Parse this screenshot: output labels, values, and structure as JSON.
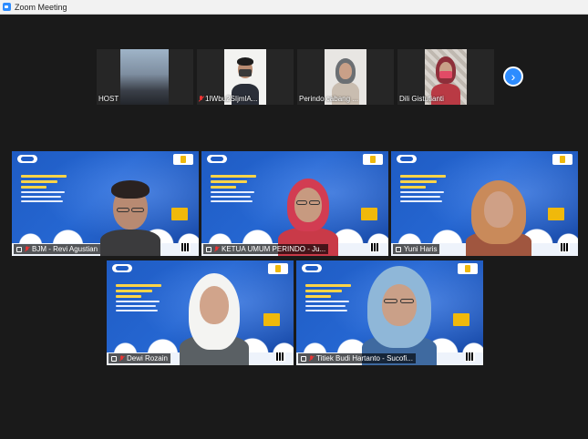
{
  "window": {
    "title": "Zoom Meeting"
  },
  "strip": {
    "tiles": [
      {
        "name": "HOST",
        "muted": false
      },
      {
        "name": "1IWbu2SIjmlA...",
        "muted": true
      },
      {
        "name": "Perindo cabang ...",
        "muted": false
      },
      {
        "name": "Dili Gistutianti",
        "muted": false
      }
    ],
    "next_icon": "chevron-right-icon"
  },
  "gallery": {
    "tiles": [
      {
        "name": "BJM - Revi Agustian",
        "muted": true
      },
      {
        "name": "KETUA UMUM PERINDO - Ju...",
        "muted": true
      },
      {
        "name": "Yuni Haris",
        "muted": false
      },
      {
        "name": "Dewi Rozain",
        "muted": true
      },
      {
        "name": "Titiek Budi Hartanto - Sucofi...",
        "muted": true
      }
    ]
  },
  "colors": {
    "background": "#1a1a1a",
    "accent": "#2d8cff",
    "slide_blue": "#1f5cc4",
    "muted_red": "#e33333"
  }
}
